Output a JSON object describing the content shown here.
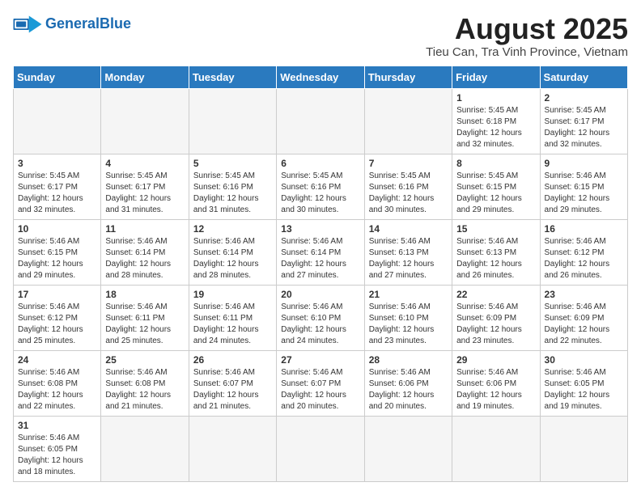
{
  "header": {
    "logo_general": "General",
    "logo_blue": "Blue",
    "title": "August 2025",
    "subtitle": "Tieu Can, Tra Vinh Province, Vietnam"
  },
  "weekdays": [
    "Sunday",
    "Monday",
    "Tuesday",
    "Wednesday",
    "Thursday",
    "Friday",
    "Saturday"
  ],
  "weeks": [
    [
      {
        "day": "",
        "info": ""
      },
      {
        "day": "",
        "info": ""
      },
      {
        "day": "",
        "info": ""
      },
      {
        "day": "",
        "info": ""
      },
      {
        "day": "",
        "info": ""
      },
      {
        "day": "1",
        "info": "Sunrise: 5:45 AM\nSunset: 6:18 PM\nDaylight: 12 hours\nand 32 minutes."
      },
      {
        "day": "2",
        "info": "Sunrise: 5:45 AM\nSunset: 6:17 PM\nDaylight: 12 hours\nand 32 minutes."
      }
    ],
    [
      {
        "day": "3",
        "info": "Sunrise: 5:45 AM\nSunset: 6:17 PM\nDaylight: 12 hours\nand 32 minutes."
      },
      {
        "day": "4",
        "info": "Sunrise: 5:45 AM\nSunset: 6:17 PM\nDaylight: 12 hours\nand 31 minutes."
      },
      {
        "day": "5",
        "info": "Sunrise: 5:45 AM\nSunset: 6:16 PM\nDaylight: 12 hours\nand 31 minutes."
      },
      {
        "day": "6",
        "info": "Sunrise: 5:45 AM\nSunset: 6:16 PM\nDaylight: 12 hours\nand 30 minutes."
      },
      {
        "day": "7",
        "info": "Sunrise: 5:45 AM\nSunset: 6:16 PM\nDaylight: 12 hours\nand 30 minutes."
      },
      {
        "day": "8",
        "info": "Sunrise: 5:45 AM\nSunset: 6:15 PM\nDaylight: 12 hours\nand 29 minutes."
      },
      {
        "day": "9",
        "info": "Sunrise: 5:46 AM\nSunset: 6:15 PM\nDaylight: 12 hours\nand 29 minutes."
      }
    ],
    [
      {
        "day": "10",
        "info": "Sunrise: 5:46 AM\nSunset: 6:15 PM\nDaylight: 12 hours\nand 29 minutes."
      },
      {
        "day": "11",
        "info": "Sunrise: 5:46 AM\nSunset: 6:14 PM\nDaylight: 12 hours\nand 28 minutes."
      },
      {
        "day": "12",
        "info": "Sunrise: 5:46 AM\nSunset: 6:14 PM\nDaylight: 12 hours\nand 28 minutes."
      },
      {
        "day": "13",
        "info": "Sunrise: 5:46 AM\nSunset: 6:14 PM\nDaylight: 12 hours\nand 27 minutes."
      },
      {
        "day": "14",
        "info": "Sunrise: 5:46 AM\nSunset: 6:13 PM\nDaylight: 12 hours\nand 27 minutes."
      },
      {
        "day": "15",
        "info": "Sunrise: 5:46 AM\nSunset: 6:13 PM\nDaylight: 12 hours\nand 26 minutes."
      },
      {
        "day": "16",
        "info": "Sunrise: 5:46 AM\nSunset: 6:12 PM\nDaylight: 12 hours\nand 26 minutes."
      }
    ],
    [
      {
        "day": "17",
        "info": "Sunrise: 5:46 AM\nSunset: 6:12 PM\nDaylight: 12 hours\nand 25 minutes."
      },
      {
        "day": "18",
        "info": "Sunrise: 5:46 AM\nSunset: 6:11 PM\nDaylight: 12 hours\nand 25 minutes."
      },
      {
        "day": "19",
        "info": "Sunrise: 5:46 AM\nSunset: 6:11 PM\nDaylight: 12 hours\nand 24 minutes."
      },
      {
        "day": "20",
        "info": "Sunrise: 5:46 AM\nSunset: 6:10 PM\nDaylight: 12 hours\nand 24 minutes."
      },
      {
        "day": "21",
        "info": "Sunrise: 5:46 AM\nSunset: 6:10 PM\nDaylight: 12 hours\nand 23 minutes."
      },
      {
        "day": "22",
        "info": "Sunrise: 5:46 AM\nSunset: 6:09 PM\nDaylight: 12 hours\nand 23 minutes."
      },
      {
        "day": "23",
        "info": "Sunrise: 5:46 AM\nSunset: 6:09 PM\nDaylight: 12 hours\nand 22 minutes."
      }
    ],
    [
      {
        "day": "24",
        "info": "Sunrise: 5:46 AM\nSunset: 6:08 PM\nDaylight: 12 hours\nand 22 minutes."
      },
      {
        "day": "25",
        "info": "Sunrise: 5:46 AM\nSunset: 6:08 PM\nDaylight: 12 hours\nand 21 minutes."
      },
      {
        "day": "26",
        "info": "Sunrise: 5:46 AM\nSunset: 6:07 PM\nDaylight: 12 hours\nand 21 minutes."
      },
      {
        "day": "27",
        "info": "Sunrise: 5:46 AM\nSunset: 6:07 PM\nDaylight: 12 hours\nand 20 minutes."
      },
      {
        "day": "28",
        "info": "Sunrise: 5:46 AM\nSunset: 6:06 PM\nDaylight: 12 hours\nand 20 minutes."
      },
      {
        "day": "29",
        "info": "Sunrise: 5:46 AM\nSunset: 6:06 PM\nDaylight: 12 hours\nand 19 minutes."
      },
      {
        "day": "30",
        "info": "Sunrise: 5:46 AM\nSunset: 6:05 PM\nDaylight: 12 hours\nand 19 minutes."
      }
    ],
    [
      {
        "day": "31",
        "info": "Sunrise: 5:46 AM\nSunset: 6:05 PM\nDaylight: 12 hours\nand 18 minutes."
      },
      {
        "day": "",
        "info": ""
      },
      {
        "day": "",
        "info": ""
      },
      {
        "day": "",
        "info": ""
      },
      {
        "day": "",
        "info": ""
      },
      {
        "day": "",
        "info": ""
      },
      {
        "day": "",
        "info": ""
      }
    ]
  ]
}
